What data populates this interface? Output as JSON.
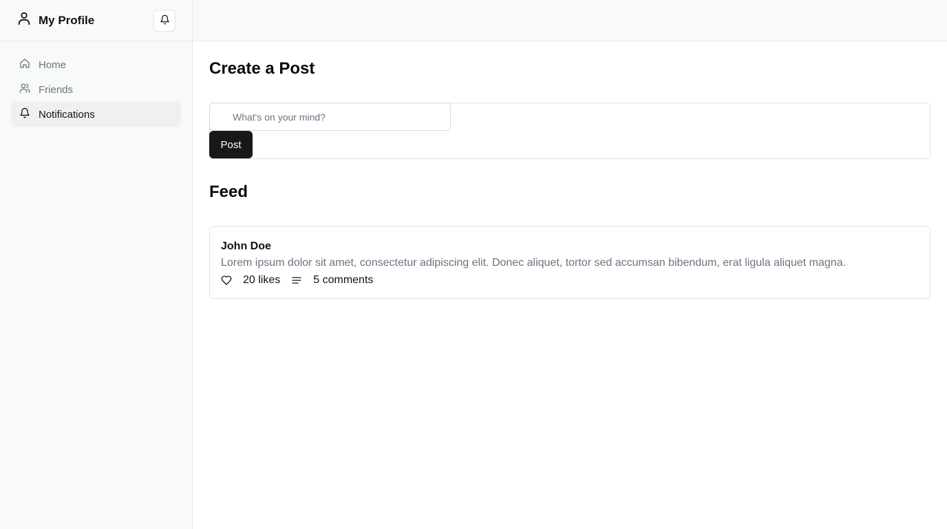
{
  "sidebar": {
    "title": "My Profile",
    "icons": {
      "profile": "user-icon",
      "bell": "bell-icon"
    },
    "items": [
      {
        "label": "Home",
        "icon": "home-icon",
        "active": false
      },
      {
        "label": "Friends",
        "icon": "users-icon",
        "active": false
      },
      {
        "label": "Notifications",
        "icon": "bell-icon",
        "active": true
      }
    ]
  },
  "create_post": {
    "title": "Create a Post",
    "placeholder": "What's on your mind?",
    "button_label": "Post"
  },
  "feed": {
    "title": "Feed",
    "posts": [
      {
        "author": "John Doe",
        "text": "Lorem ipsum dolor sit amet, consectetur adipiscing elit. Donec aliquet, tortor sed accumsan bibendum, erat ligula aliquet magna.",
        "likes": "20 likes",
        "comments": "5 comments"
      }
    ]
  },
  "colors": {
    "sidebar_bg": "#f8f9f9",
    "active_item_bg": "#eff0f2",
    "button_bg": "#18181b",
    "muted_text": "#6b7280"
  }
}
